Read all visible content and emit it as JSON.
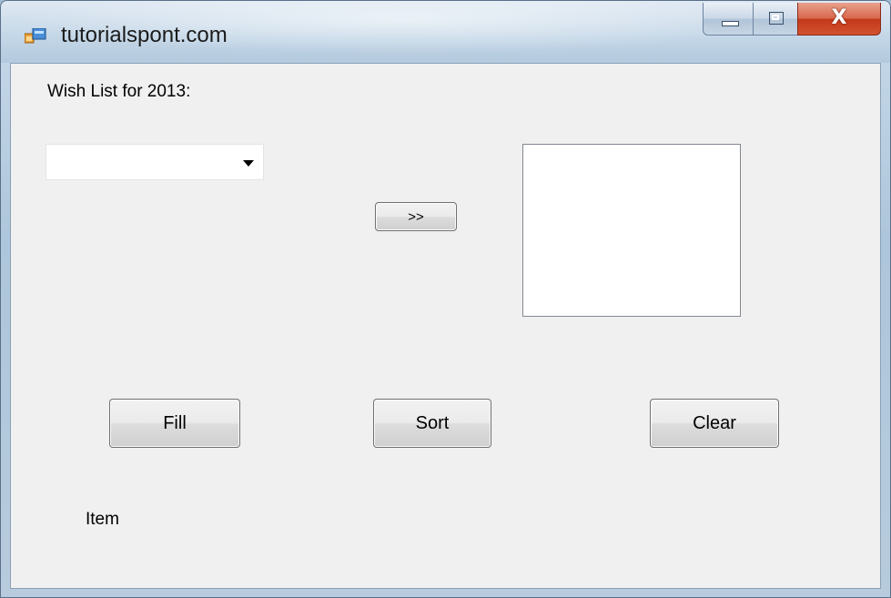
{
  "window": {
    "title": "tutorialspont.com",
    "controls": {
      "minimize": "minimize",
      "maximize": "maximize",
      "close": "X"
    }
  },
  "form": {
    "wish_label": "Wish List for 2013:",
    "combo": {
      "value": ""
    },
    "move_button": ">>",
    "listbox": {
      "items": []
    },
    "fill_button": "Fill",
    "sort_button": "Sort",
    "clear_button": "Clear",
    "item_label": "Item"
  },
  "colors": {
    "client_background": "#f0f0f0",
    "close_button": "#c3381b",
    "titlebar": "#c3d6e7"
  },
  "icons": [
    "app-form-icon",
    "minimize-icon",
    "maximize-icon",
    "close-icon",
    "dropdown-arrow-icon"
  ]
}
